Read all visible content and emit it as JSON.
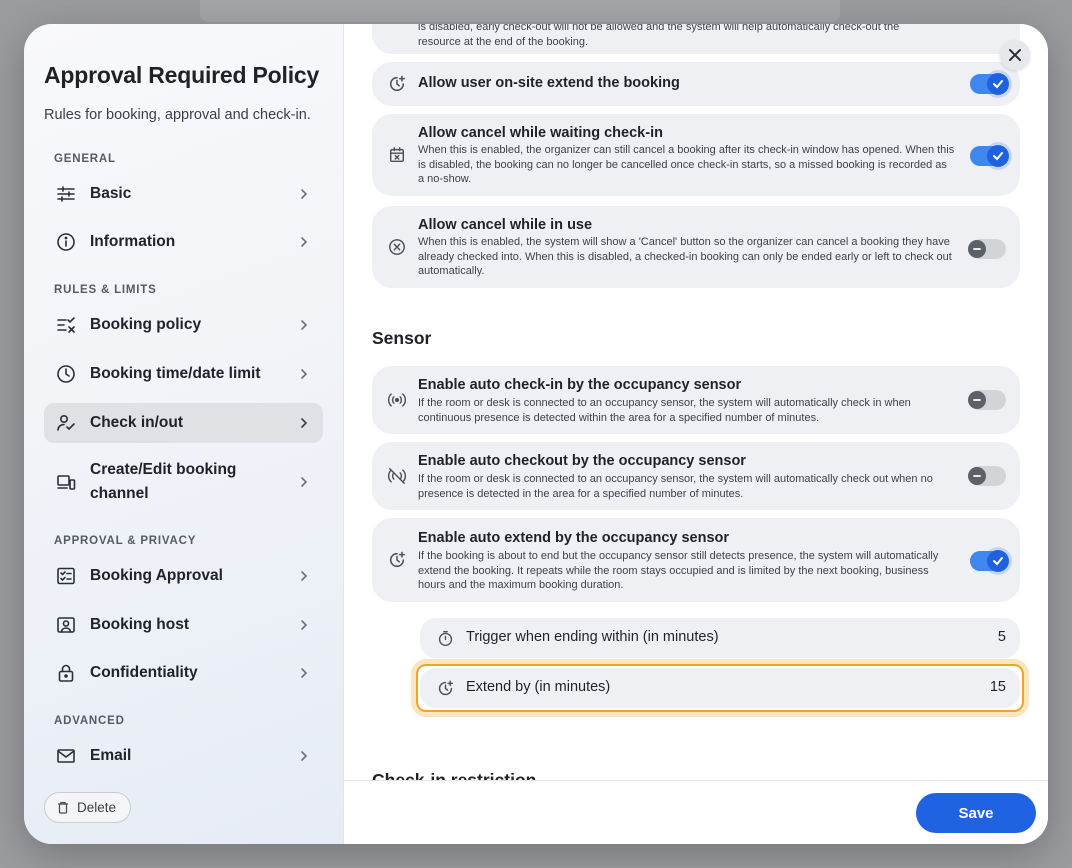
{
  "sidebar": {
    "title": "Approval Required Policy",
    "subtitle": "Rules for booking, approval and check-in.",
    "sections": {
      "general": "GENERAL",
      "rules": "RULES & LIMITS",
      "approval": "APPROVAL & PRIVACY",
      "advanced": "ADVANCED"
    },
    "items": {
      "basic": "Basic",
      "information": "Information",
      "booking_policy": "Booking policy",
      "time_limit": "Booking time/date limit",
      "check_in_out": "Check in/out",
      "create_edit": "Create/Edit booking channel",
      "booking_approval": "Booking Approval",
      "booking_host": "Booking host",
      "confidentiality": "Confidentiality",
      "email": "Email"
    },
    "delete_label": "Delete",
    "active_item": "check_in_out"
  },
  "main": {
    "top_partial_desc": "is disabled, early check-out will not be allowed and the system will help automatically check-out the resource at the end of the booking.",
    "cards": {
      "extend": {
        "title": "Allow user on-site extend the booking",
        "toggle": "on"
      },
      "cancel_waiting": {
        "title": "Allow cancel while waiting check-in",
        "desc": "When this is enabled, the organizer can still cancel a booking after its check-in window has opened. When this is disabled, the booking can no longer be cancelled once check-in starts, so a missed booking is recorded as a no-show.",
        "toggle": "on"
      },
      "cancel_in_use": {
        "title": "Allow cancel while in use",
        "desc": "When this is enabled, the system will show a 'Cancel' button so the organizer can cancel a booking they have already checked into. When this is disabled, a checked-in booking can only be ended early or left to check out automatically.",
        "toggle": "off"
      }
    },
    "sensor_heading": "Sensor",
    "sensor_cards": {
      "auto_checkin": {
        "title": "Enable auto check-in by the occupancy sensor",
        "desc": "If the room or desk is connected to an occupancy sensor, the system will automatically check in when continuous presence is detected within the area for a specified number of minutes.",
        "toggle": "off"
      },
      "auto_checkout": {
        "title": "Enable auto checkout by the occupancy sensor",
        "desc": "If the room or desk is connected to an occupancy sensor, the system will automatically check out when no presence is detected in the area for a specified number of minutes.",
        "toggle": "off"
      },
      "auto_extend": {
        "title": "Enable auto extend by the occupancy sensor",
        "desc": "If the booking is about to end but the occupancy sensor still detects presence, the system will automatically extend the booking. It repeats while the room stays occupied and is limited by the next booking, business hours and the maximum booking duration.",
        "toggle": "on"
      }
    },
    "sub_settings": {
      "trigger": {
        "label": "Trigger when ending within (in minutes)",
        "value": "5"
      },
      "extend_by": {
        "label": "Extend by (in minutes)",
        "value": "15"
      }
    },
    "next_heading_partial": "Check-in restriction"
  },
  "footer": {
    "save_label": "Save"
  },
  "colors": {
    "accent": "#1f63e2",
    "toggle_on": "#3f86ee",
    "highlight": "#f0a423",
    "card_bg": "#eef0f3"
  }
}
